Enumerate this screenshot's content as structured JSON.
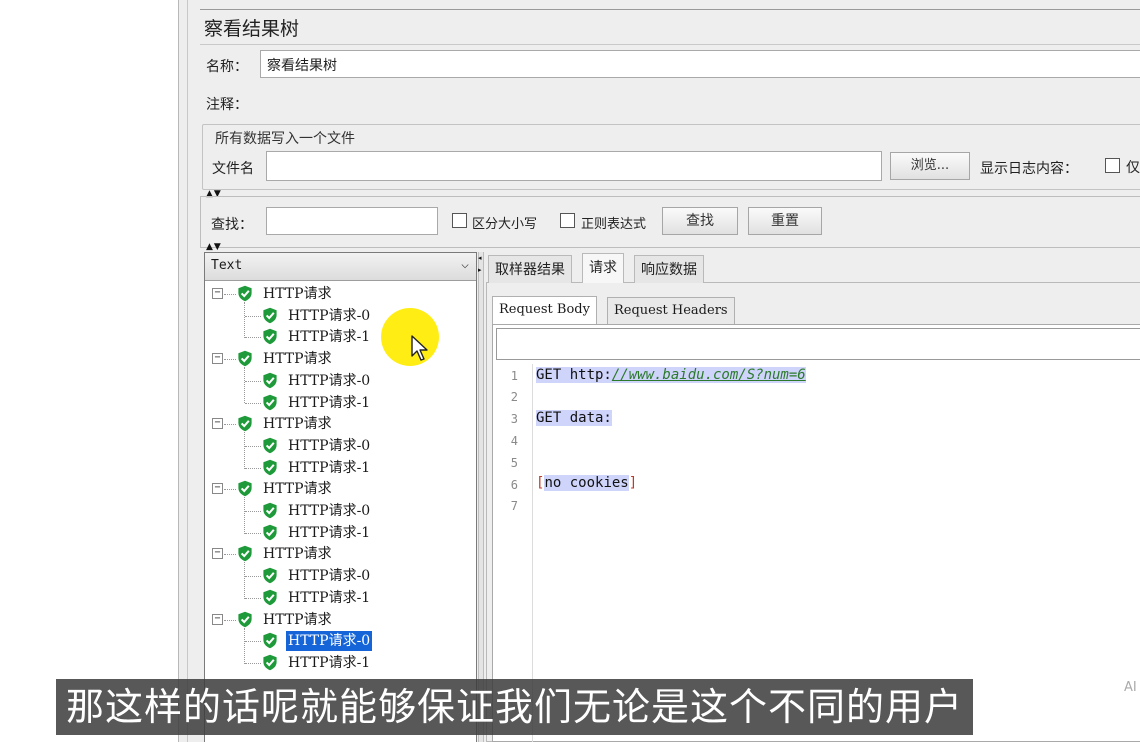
{
  "title": "察看结果树",
  "name_label": "名称：",
  "name_value": "察看结果树",
  "comment_label": "注释：",
  "file_group": {
    "title": "所有数据写入一个文件",
    "filename_label": "文件名",
    "browse_button": "浏览...",
    "log_label": "显示日志内容：",
    "only_label_partial": "仅"
  },
  "search": {
    "label": "查找：",
    "case_label": "区分大小写",
    "regex_label": "正则表达式",
    "find_button": "查找",
    "reset_button": "重置"
  },
  "tree": {
    "renderer": "Text",
    "groups": [
      {
        "label": "HTTP请求",
        "children": [
          "HTTP请求-0",
          "HTTP请求-1"
        ]
      },
      {
        "label": "HTTP请求",
        "children": [
          "HTTP请求-0",
          "HTTP请求-1"
        ]
      },
      {
        "label": "HTTP请求",
        "children": [
          "HTTP请求-0",
          "HTTP请求-1"
        ]
      },
      {
        "label": "HTTP请求",
        "children": [
          "HTTP请求-0",
          "HTTP请求-1"
        ]
      },
      {
        "label": "HTTP请求",
        "children": [
          "HTTP请求-0",
          "HTTP请求-1"
        ]
      },
      {
        "label": "HTTP请求",
        "children": [
          "HTTP请求-0",
          "HTTP请求-1"
        ]
      }
    ],
    "selected": "HTTP请求-0"
  },
  "result_tabs": [
    "取样器结果",
    "请求",
    "响应数据"
  ],
  "active_result_tab": "请求",
  "request_tabs": [
    "Request Body",
    "Request Headers"
  ],
  "active_request_tab": "Request Body",
  "code_lines": {
    "n1": "1",
    "n2": "2",
    "n3": "3",
    "n4": "4",
    "n5": "5",
    "n6": "6",
    "n7": "7",
    "l1_prefix": "GET http:",
    "l1_url": "//www.baidu.com/S?num=6",
    "l3": "GET data:",
    "l6_open": "[",
    "l6_text": "no cookies",
    "l6_close": "]"
  },
  "subtitle": "那这样的话呢就能够保证我们无论是这个不同的用户",
  "badge": "AI",
  "icons": {
    "success": "green-shield-check-icon",
    "expand": "collapse-minus-icon",
    "combo": "chevron-down-icon"
  },
  "colors": {
    "selection": "#1665d8",
    "success_green": "#1f9a3a",
    "highlight": "#cfd4fb",
    "cursor": "#ffec00"
  }
}
